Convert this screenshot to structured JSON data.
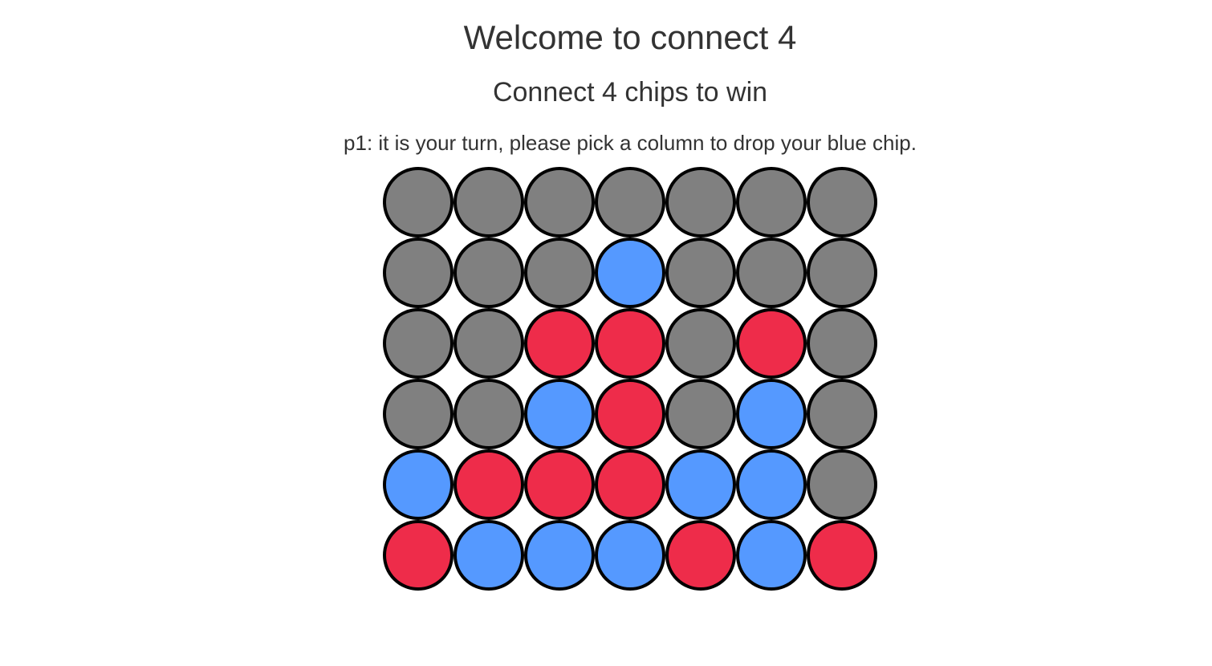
{
  "header": {
    "title": "Welcome to connect 4",
    "subtitle": "Connect 4 chips to win",
    "status": "p1: it is your turn, please pick a column to drop your blue chip."
  },
  "colors": {
    "empty": "#808080",
    "blue": "#5599ff",
    "red": "#ee2c4a",
    "border": "#000000"
  },
  "board": {
    "columns": 7,
    "rows": [
      [
        "empty",
        "empty",
        "empty",
        "empty",
        "empty",
        "empty",
        "empty"
      ],
      [
        "empty",
        "empty",
        "empty",
        "blue",
        "empty",
        "empty",
        "empty"
      ],
      [
        "empty",
        "empty",
        "red",
        "red",
        "empty",
        "red",
        "empty"
      ],
      [
        "empty",
        "empty",
        "blue",
        "red",
        "empty",
        "blue",
        "empty"
      ],
      [
        "blue",
        "red",
        "red",
        "red",
        "blue",
        "blue",
        "empty"
      ],
      [
        "red",
        "blue",
        "blue",
        "blue",
        "red",
        "blue",
        "red"
      ]
    ]
  }
}
